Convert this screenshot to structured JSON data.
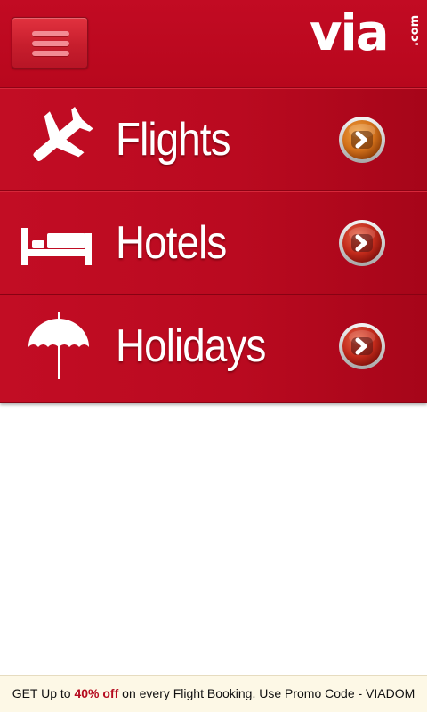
{
  "header": {
    "logo_main": "via",
    "logo_suffix": ".com",
    "menu_icon": "hamburger-icon"
  },
  "menu": {
    "items": [
      {
        "label": "Flights",
        "icon": "airplane-icon",
        "arrow_color": "#e0801f"
      },
      {
        "label": "Hotels",
        "icon": "bed-icon",
        "arrow_color": "#c9301f"
      },
      {
        "label": "Holidays",
        "icon": "umbrella-icon",
        "arrow_color": "#c9301f"
      }
    ]
  },
  "promo": {
    "prefix": "GET Up to ",
    "highlight": "40% off",
    "suffix": " on every Flight Booking. Use Promo Code - VIADOM"
  },
  "colors": {
    "brand_red": "#c20d24",
    "promo_bg": "#fdf8e6",
    "promo_highlight": "#b50a1e"
  }
}
